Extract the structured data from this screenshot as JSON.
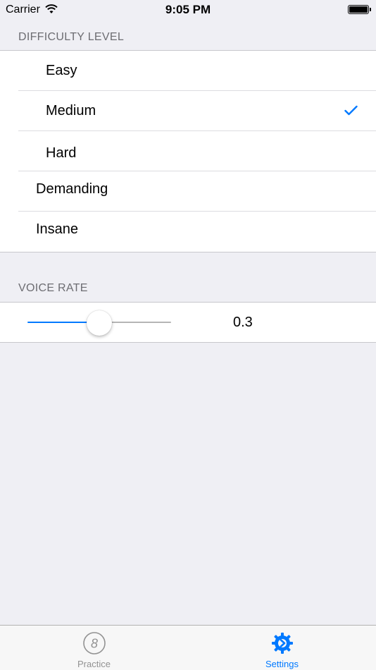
{
  "status_bar": {
    "carrier": "Carrier",
    "time": "9:05 PM",
    "icons": [
      "wifi-icon",
      "battery-icon"
    ]
  },
  "difficulty": {
    "header": "DIFFICULTY LEVEL",
    "options": [
      {
        "label": "Easy",
        "selected": false
      },
      {
        "label": "Medium",
        "selected": true
      },
      {
        "label": "Hard",
        "selected": false
      },
      {
        "label": "Demanding",
        "selected": false
      },
      {
        "label": "Insane",
        "selected": false
      }
    ],
    "checkmark_icon": "checkmark-icon",
    "accent_color": "#0079ff"
  },
  "voice_rate": {
    "header": "VOICE RATE",
    "value": "0.3",
    "slider_fraction": 0.5
  },
  "tab_bar": {
    "tabs": [
      {
        "label": "Practice",
        "icon": "practice-8-icon",
        "active": false
      },
      {
        "label": "Settings",
        "icon": "settings-gear-icon",
        "active": true
      }
    ],
    "active_color": "#0079ff",
    "inactive_color": "#929292"
  },
  "colors": {
    "background": "#efeff4",
    "cell": "#ffffff",
    "section_header": "#6d6d72"
  }
}
